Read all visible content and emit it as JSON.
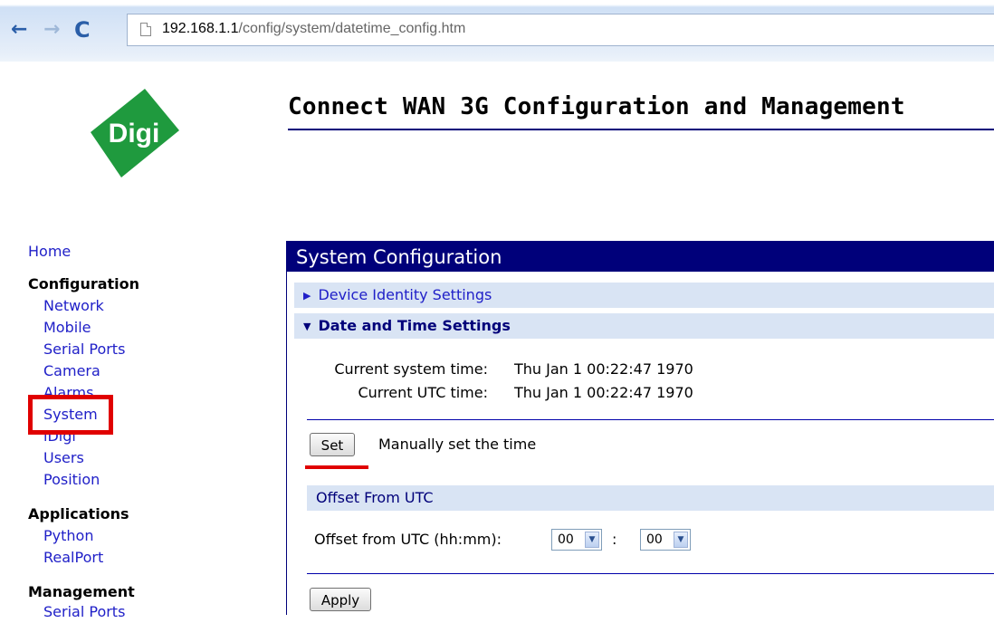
{
  "browser": {
    "back_glyph": "←",
    "forward_glyph": "→",
    "reload_glyph": "C",
    "url_host": "192.168.1.1",
    "url_path": "/config/system/datetime_config.htm"
  },
  "header": {
    "logo_text": "Digi",
    "title": "Connect WAN 3G Configuration and Management"
  },
  "menu": {
    "home": "Home",
    "configuration": {
      "label": "Configuration",
      "items": [
        "Network",
        "Mobile",
        "Serial Ports",
        "Camera",
        "Alarms",
        "System",
        "iDigi",
        "Users",
        "Position"
      ]
    },
    "applications": {
      "label": "Applications",
      "items": [
        "Python",
        "RealPort"
      ]
    },
    "management": {
      "label": "Management",
      "items": [
        "Serial Ports"
      ]
    }
  },
  "main": {
    "panel_title": "System Configuration",
    "device_identity": "Device Identity Settings",
    "date_time": "Date and Time Settings",
    "current_system_time_label": "Current system time:",
    "current_system_time_value": "Thu Jan 1 00:22:47 1970",
    "current_utc_time_label": "Current UTC time:",
    "current_utc_time_value": "Thu Jan 1 00:22:47 1970",
    "set_button": "Set",
    "set_description": "Manually set the time",
    "offset_section": "Offset From UTC",
    "offset_label": "Offset from UTC (hh:mm):",
    "offset_hours": "00",
    "offset_separator": ":",
    "offset_minutes": "00",
    "apply_button": "Apply"
  },
  "colors": {
    "nav_link": "#2020c8",
    "panel_header": "#00007a",
    "section_bar": "#d9e4f4",
    "highlight": "#e00000"
  }
}
